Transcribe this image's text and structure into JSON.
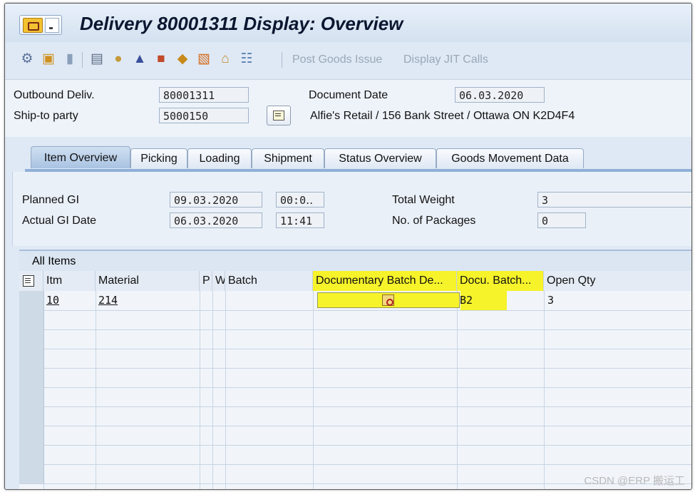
{
  "window": {
    "title": "Delivery 80001311 Display: Overview"
  },
  "toolbar": {
    "icons": [
      "glasses-icon",
      "new-icon",
      "delete-icon",
      "goto-icon",
      "partner-icon",
      "hat-icon",
      "texts-icon",
      "box-icon",
      "packing-icon",
      "house-icon",
      "grid-icon"
    ],
    "post_goods_issue": "Post Goods Issue",
    "display_jit_calls": "Display JIT Calls"
  },
  "header": {
    "outbound_label": "Outbound Deliv.",
    "outbound_value": "80001311",
    "document_date_label": "Document Date",
    "document_date_value": "06.03.2020",
    "ship_to_label": "Ship-to party",
    "ship_to_value": "5000150",
    "ship_to_address": "Alfie's Retail / 156 Bank Street / Ottawa ON K2D4F4"
  },
  "tabs": [
    {
      "label": "Item Overview",
      "active": true
    },
    {
      "label": "Picking"
    },
    {
      "label": "Loading"
    },
    {
      "label": "Shipment"
    },
    {
      "label": "Status Overview"
    },
    {
      "label": "Goods Movement Data"
    }
  ],
  "overview": {
    "planned_gi_label": "Planned GI",
    "planned_gi_date": "09.03.2020",
    "planned_gi_time": "00:0‥",
    "actual_gi_label": "Actual GI Date",
    "actual_gi_date": "06.03.2020",
    "actual_gi_time": "11:41",
    "total_weight_label": "Total Weight",
    "total_weight_value": "3",
    "packages_label": "No. of Packages",
    "packages_value": "0"
  },
  "grid": {
    "title": "All Items",
    "columns": [
      "Itm",
      "Material",
      "P",
      "W",
      "Batch",
      "Documentary Batch De...",
      "Docu. Batch...",
      "Open Qty"
    ],
    "highlight_color": "#f6f32a",
    "rows": [
      {
        "itm": "10",
        "material": "214",
        "batch": "",
        "docu_batch": "B2",
        "open_qty": "3"
      }
    ]
  },
  "watermark": "CSDN @ERP 搬运工"
}
